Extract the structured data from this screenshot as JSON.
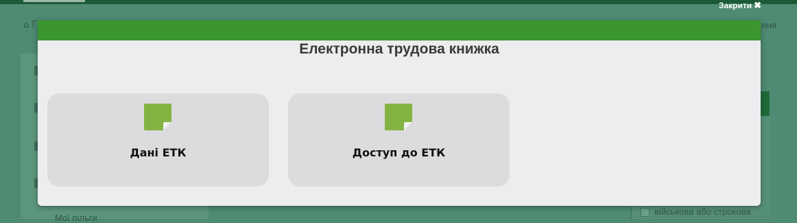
{
  "background": {
    "breadcrumb_left": "Г",
    "breadcrumb_right": "ння",
    "sidebar_item": "Мої пільги",
    "right_panel_text": "військова або строкова"
  },
  "close": {
    "label": "Закрити",
    "icon": "close-icon"
  },
  "modal": {
    "title": "Електронна трудова книжка",
    "header_color": "#3b9630",
    "cards": [
      {
        "label": "Дані ЕТК",
        "icon": "note-icon"
      },
      {
        "label": "Доступ до ЕТК",
        "icon": "note-icon"
      }
    ]
  },
  "colors": {
    "accent": "#3b9630",
    "icon_green": "#83b443"
  }
}
